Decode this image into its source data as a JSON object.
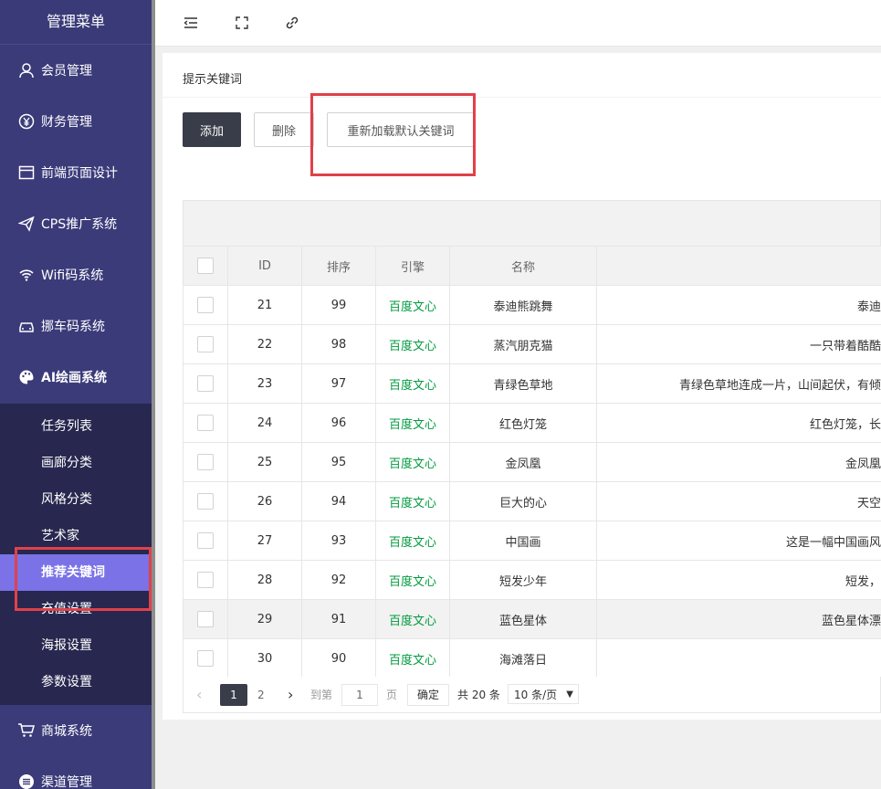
{
  "sidebar": {
    "title": "管理菜单",
    "items": [
      {
        "label": "会员管理",
        "icon": "user-icon"
      },
      {
        "label": "财务管理",
        "icon": "yen-icon"
      },
      {
        "label": "前端页面设计",
        "icon": "layout-icon"
      },
      {
        "label": "CPS推广系统",
        "icon": "paper-plane-icon"
      },
      {
        "label": "Wifi码系统",
        "icon": "wifi-icon"
      },
      {
        "label": "挪车码系统",
        "icon": "car-icon"
      },
      {
        "label": "AI绘画系统",
        "icon": "palette-icon"
      }
    ],
    "submenu": [
      {
        "label": "任务列表"
      },
      {
        "label": "画廊分类"
      },
      {
        "label": "风格分类"
      },
      {
        "label": "艺术家"
      },
      {
        "label": "推荐关键词",
        "active": true
      },
      {
        "label": "充值设置"
      },
      {
        "label": "海报设置"
      },
      {
        "label": "参数设置"
      }
    ],
    "bottom_items": [
      {
        "label": "商城系统",
        "icon": "cart-icon"
      },
      {
        "label": "渠道管理",
        "icon": "list-icon"
      }
    ]
  },
  "topbar": {
    "icons": [
      "menu-fold-icon",
      "fullscreen-icon",
      "link-icon"
    ]
  },
  "card": {
    "title": "提示关键词",
    "buttons": {
      "add": "添加",
      "delete": "删除",
      "reload": "重新加载默认关键词"
    }
  },
  "table": {
    "columns": [
      "ID",
      "排序",
      "引擎",
      "名称"
    ],
    "rows": [
      {
        "id": "21",
        "sort": "99",
        "engine": "百度文心",
        "name": "泰迪熊跳舞",
        "desc": "泰迪"
      },
      {
        "id": "22",
        "sort": "98",
        "engine": "百度文心",
        "name": "蒸汽朋克猫",
        "desc": "一只带着酷酷"
      },
      {
        "id": "23",
        "sort": "97",
        "engine": "百度文心",
        "name": "青绿色草地",
        "desc": "青绿色草地连成一片，山间起伏，有倾"
      },
      {
        "id": "24",
        "sort": "96",
        "engine": "百度文心",
        "name": "红色灯笼",
        "desc": "红色灯笼，长"
      },
      {
        "id": "25",
        "sort": "95",
        "engine": "百度文心",
        "name": "金凤凰",
        "desc": "金凤凰"
      },
      {
        "id": "26",
        "sort": "94",
        "engine": "百度文心",
        "name": "巨大的心",
        "desc": "天空"
      },
      {
        "id": "27",
        "sort": "93",
        "engine": "百度文心",
        "name": "中国画",
        "desc": "这是一幅中国画风"
      },
      {
        "id": "28",
        "sort": "92",
        "engine": "百度文心",
        "name": "短发少年",
        "desc": "短发，"
      },
      {
        "id": "29",
        "sort": "91",
        "engine": "百度文心",
        "name": "蓝色星体",
        "desc": "蓝色星体漂"
      },
      {
        "id": "30",
        "sort": "90",
        "engine": "百度文心",
        "name": "海滩落日",
        "desc": ""
      }
    ]
  },
  "pager": {
    "pages": [
      "1",
      "2"
    ],
    "current": "1",
    "goto_label": "到第",
    "goto_value": "1",
    "page_unit": "页",
    "confirm": "确定",
    "total": "共 20 条",
    "page_size": "10 条/页"
  },
  "colors": {
    "sidebar_bg": "#3b3b7a",
    "submenu_bg": "#27274f",
    "active_item": "#7a72e6",
    "engine_text": "#009a3e",
    "highlight_box": "#e0414a"
  }
}
